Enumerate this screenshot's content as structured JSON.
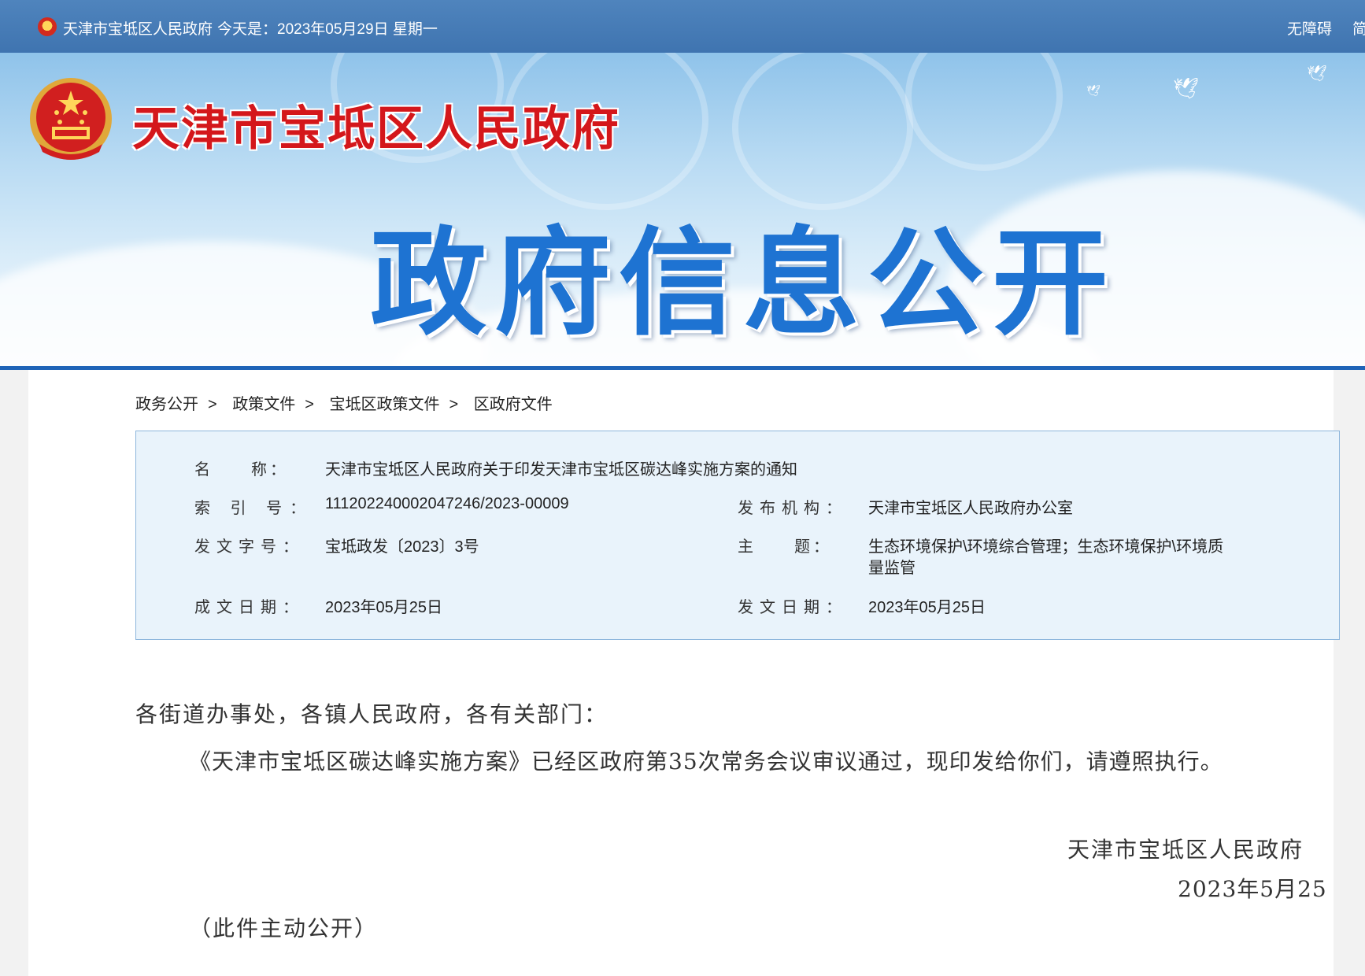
{
  "topbar": {
    "site_name": "天津市宝坻区人民政府",
    "today": "今天是：2023年05月29日 星期一",
    "accessibility": "无障碍",
    "simplified": "简"
  },
  "banner": {
    "site_name": "天津市宝坻区人民政府",
    "title": "政府信息公开"
  },
  "breadcrumb": [
    {
      "label": "政务公开"
    },
    {
      "label": "政策文件"
    },
    {
      "label": "宝坻区政策文件"
    },
    {
      "label": "区政府文件"
    }
  ],
  "breadcrumb_sep": ">",
  "info": {
    "name_label": "名　　称：",
    "name_value": "天津市宝坻区人民政府关于印发天津市宝坻区碳达峰实施方案的通知",
    "index_label": "索 引 号：",
    "index_value": "111202240002047246/2023-00009",
    "publisher_label": "发布机构：",
    "publisher_value": "天津市宝坻区人民政府办公室",
    "doc_no_label": "发文字号：",
    "doc_no_value": "宝坻政发〔2023〕3号",
    "subject_label": "主　　题：",
    "subject_value_1": "生态环境保护\\环境综合管理；生态环境保护\\环境质",
    "subject_value_2": "量监管",
    "written_date_label": "成文日期：",
    "written_date_value": "2023年05月25日",
    "issue_date_label": "发文日期：",
    "issue_date_value": "2023年05月25日"
  },
  "document": {
    "salutation": "各街道办事处，各镇人民政府，各有关部门：",
    "paragraph": "《天津市宝坻区碳达峰实施方案》已经区政府第35次常务会议审议通过，现印发给你们，请遵照执行。",
    "signature": "天津市宝坻区人民政府",
    "date": "2023年5月25",
    "note": "（此件主动公开）"
  }
}
